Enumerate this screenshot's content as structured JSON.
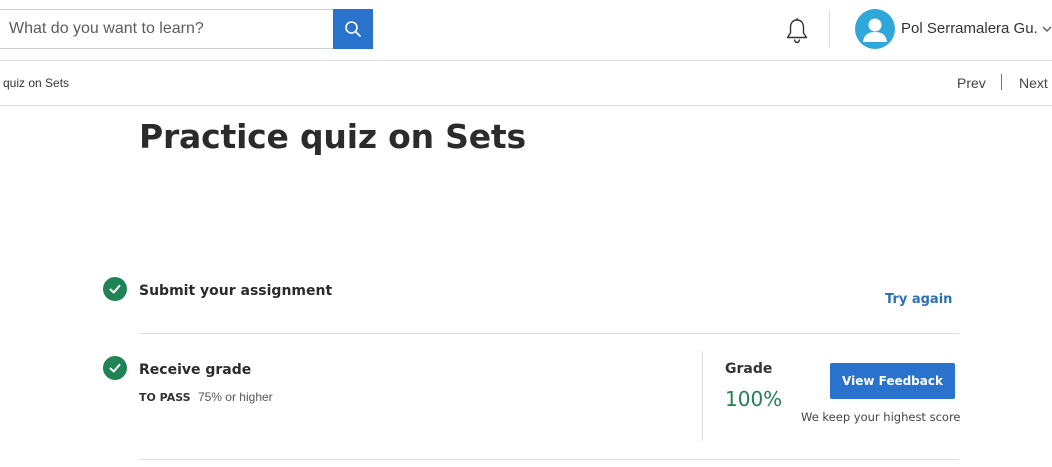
{
  "header": {
    "search": {
      "placeholder": "What do you want to learn?",
      "value": "",
      "icon": "search-icon"
    },
    "notifications_icon": "bell-icon",
    "user": {
      "name": "Pol Serramalera Gu...",
      "avatar_icon": "user-avatar-icon",
      "menu_icon": "chevron-down-icon"
    }
  },
  "nav": {
    "breadcrumb": "quiz on Sets",
    "prev_label": "Prev",
    "next_label": "Next"
  },
  "main": {
    "title": "Practice quiz on Sets",
    "steps": [
      {
        "status": "complete",
        "title": "Submit your assignment",
        "action_label": "Try again"
      },
      {
        "status": "complete",
        "title": "Receive grade",
        "pass_label": "TO PASS",
        "pass_requirement": "75% or higher"
      }
    ],
    "grade": {
      "label": "Grade",
      "value": "100%",
      "feedback_button": "View Feedback",
      "note": "We keep your highest score"
    }
  },
  "colors": {
    "accent_blue": "#2a73cc",
    "success_green": "#1f8354",
    "avatar_bg": "#2fa7d8",
    "link_blue": "#2a6fb8"
  }
}
